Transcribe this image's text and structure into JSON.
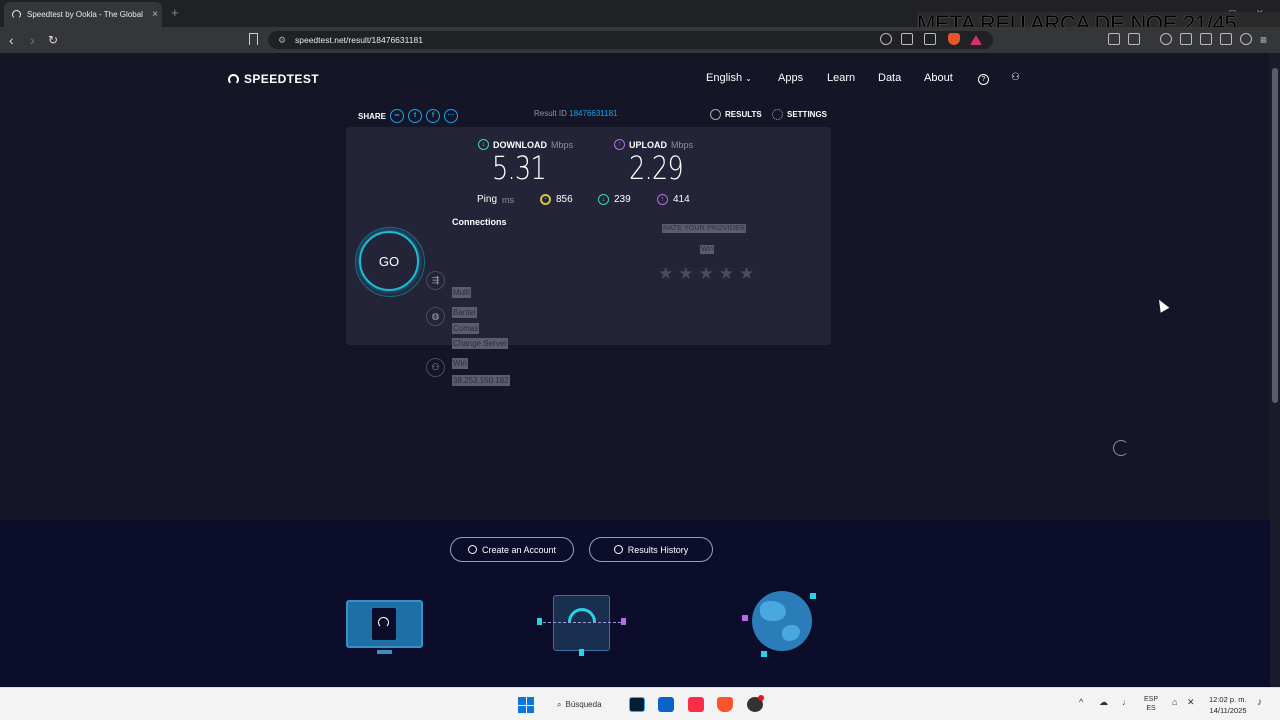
{
  "browser": {
    "tab_title": "Speedtest by Ookla - The Global",
    "tab_close": "×",
    "new_tab": "+",
    "url": "speedtest.net/result/18476631181",
    "overlay_text": "META REU ARCA DE NOE 21/45"
  },
  "header": {
    "logo": "SPEEDTEST",
    "nav": [
      "English",
      "Apps",
      "Learn",
      "Data",
      "About"
    ]
  },
  "result_bar": {
    "share_label": "SHARE",
    "result_id_label": "Result ID",
    "result_id": "18476631181",
    "results_label": "RESULTS",
    "settings_label": "SETTINGS"
  },
  "metrics": {
    "download_label": "DOWNLOAD",
    "upload_label": "UPLOAD",
    "unit": "Mbps",
    "download_value": "5.31",
    "upload_value": "2.29",
    "ping_label": "Ping",
    "ping_unit": "ms",
    "ping_idle": "856",
    "ping_download": "239",
    "ping_upload": "414"
  },
  "test": {
    "go_label": "GO",
    "connections_label": "Connections",
    "connections_mode": "Multi",
    "server_name": "Bantel",
    "server_location": "Comas",
    "change_server": "Change Server",
    "isp_name": "Win",
    "ip_address": "38.253.150.182"
  },
  "rating": {
    "prompt": "RATE YOUR PROVIDER",
    "provider": "Win",
    "star_count": 5
  },
  "bottom": {
    "create_account": "Create an Account",
    "results_history": "Results History"
  },
  "taskbar": {
    "search_label": "Búsqueda",
    "lang_top": "ESP",
    "lang_bottom": "ES",
    "time": "12:02 p. m.",
    "date": "14/11/2025"
  },
  "colors": {
    "accent_cyan": "#1bbbd9",
    "link_blue": "#1ba3e8",
    "download_green": "#3ad6b8",
    "upload_purple": "#b86ae8",
    "idle_yellow": "#d8c43a"
  }
}
